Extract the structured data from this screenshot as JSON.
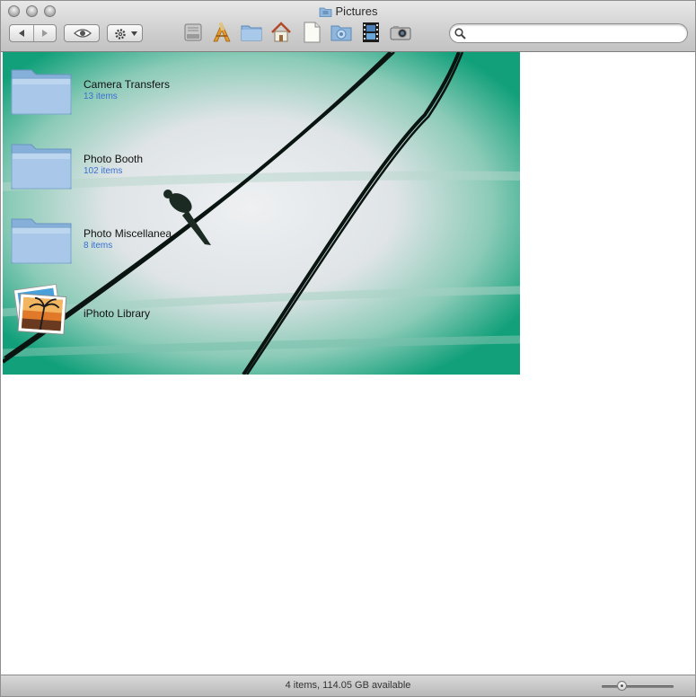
{
  "window": {
    "title": "Pictures"
  },
  "toolbar": {
    "icons": [
      "hard-disk-icon",
      "applications-icon",
      "folder-icon",
      "home-icon",
      "document-icon",
      "downloads-folder-icon",
      "movies-icon",
      "camera-icon"
    ],
    "search": {
      "value": "",
      "placeholder": ""
    }
  },
  "items": [
    {
      "name": "Camera Transfers",
      "count": "13 items",
      "icon": "folder-icon"
    },
    {
      "name": "Photo Booth",
      "count": "102 items",
      "icon": "folder-icon"
    },
    {
      "name": "Photo Miscellanea",
      "count": "8 items",
      "icon": "folder-icon"
    },
    {
      "name": "iPhoto Library",
      "count": "",
      "icon": "iphoto-library-icon"
    }
  ],
  "statusbar": {
    "text": "4 items, 114.05 GB available",
    "icon_size_fraction": 0.25
  },
  "colors": {
    "folder_blue": "#9fc3e6",
    "count_blue": "#3a6fd0",
    "background_teal": "#1a9e7a"
  }
}
